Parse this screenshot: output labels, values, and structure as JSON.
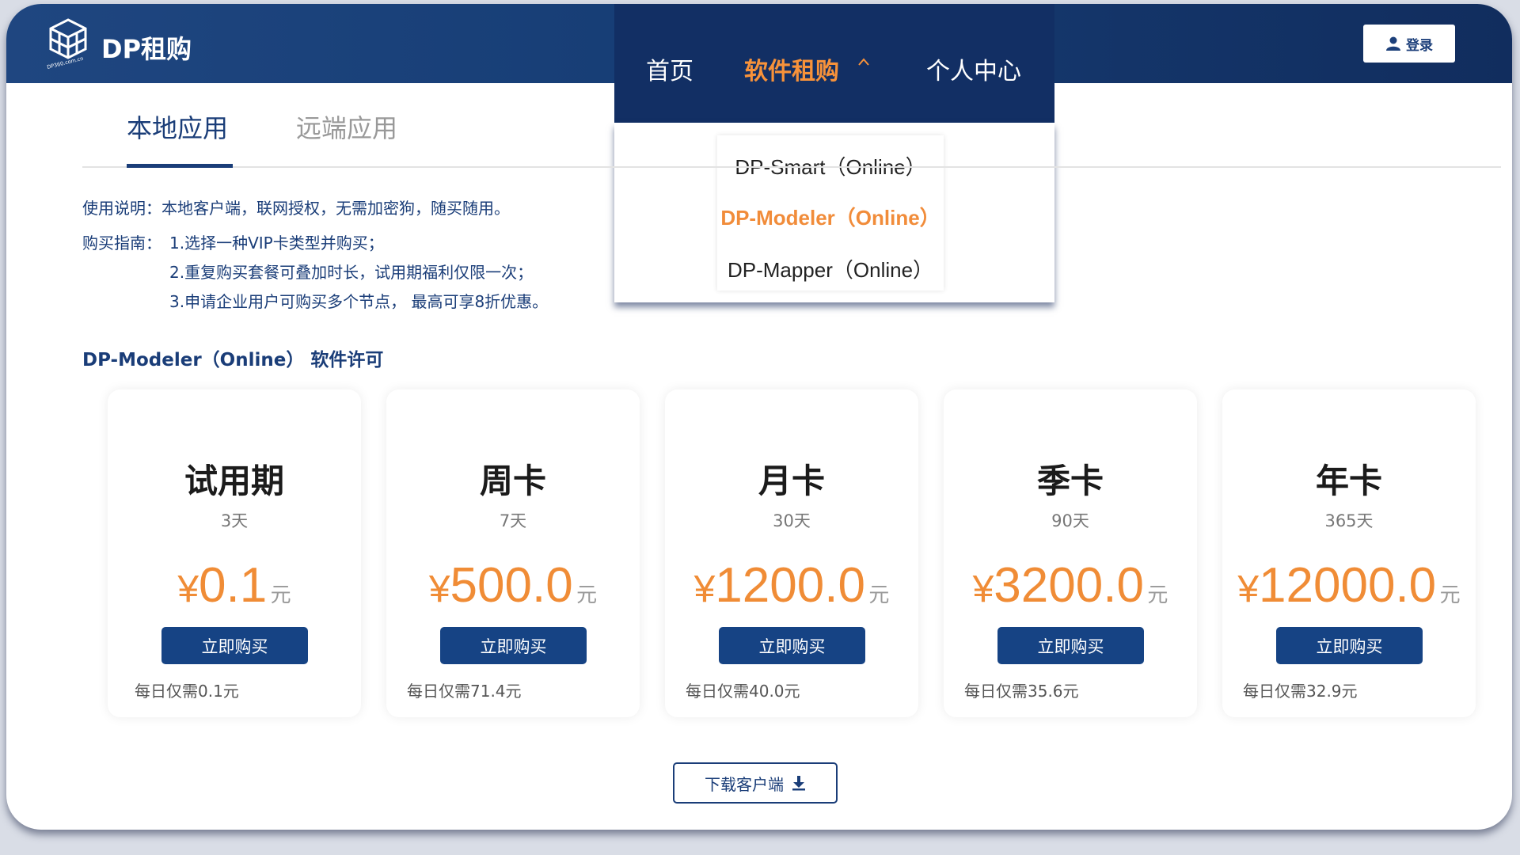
{
  "header": {
    "brand": "DP租购",
    "logo_caption": "DP360.com.cn",
    "login_label": "登录"
  },
  "nav": {
    "items": [
      {
        "label": "首页",
        "active": false
      },
      {
        "label": "软件租购",
        "active": true
      },
      {
        "label": "个人中心",
        "active": false
      }
    ],
    "dropdown": [
      {
        "label": "DP-Smart（Online）",
        "active": false
      },
      {
        "label": "DP-Modeler（Online）",
        "active": true
      },
      {
        "label": "DP-Mapper（Online）",
        "active": false
      }
    ]
  },
  "tabs": [
    {
      "label": "本地应用",
      "active": true
    },
    {
      "label": "远端应用",
      "active": false
    }
  ],
  "instructions": {
    "usage": "使用说明：本地客户端，联网授权，无需加密狗，随买随用。",
    "guide_label": "购买指南：",
    "guide_steps": [
      "1.选择一种VIP卡类型并购买；",
      "2.重复购买套餐可叠加时长，试用期福利仅限一次；",
      "3.申请企业用户可购买多个节点， 最高可享8折优惠。"
    ]
  },
  "section_title": "DP-Modeler（Online） 软件许可",
  "currency_symbol": "¥",
  "unit": "元",
  "buy_label": "立即购买",
  "plans": [
    {
      "name": "试用期",
      "days": "3天",
      "price": "0.1",
      "daily": "每日仅需0.1元"
    },
    {
      "name": "周卡",
      "days": "7天",
      "price": "500.0",
      "daily": "每日仅需71.4元"
    },
    {
      "name": "月卡",
      "days": "30天",
      "price": "1200.0",
      "daily": "每日仅需40.0元"
    },
    {
      "name": "季卡",
      "days": "90天",
      "price": "3200.0",
      "daily": "每日仅需35.6元"
    },
    {
      "name": "年卡",
      "days": "365天",
      "price": "12000.0",
      "daily": "每日仅需32.9元"
    }
  ],
  "download_label": "下载客户端",
  "colors": {
    "primary": "#1a3d78",
    "accent": "#f08c36",
    "header_bg": "#173e76"
  }
}
